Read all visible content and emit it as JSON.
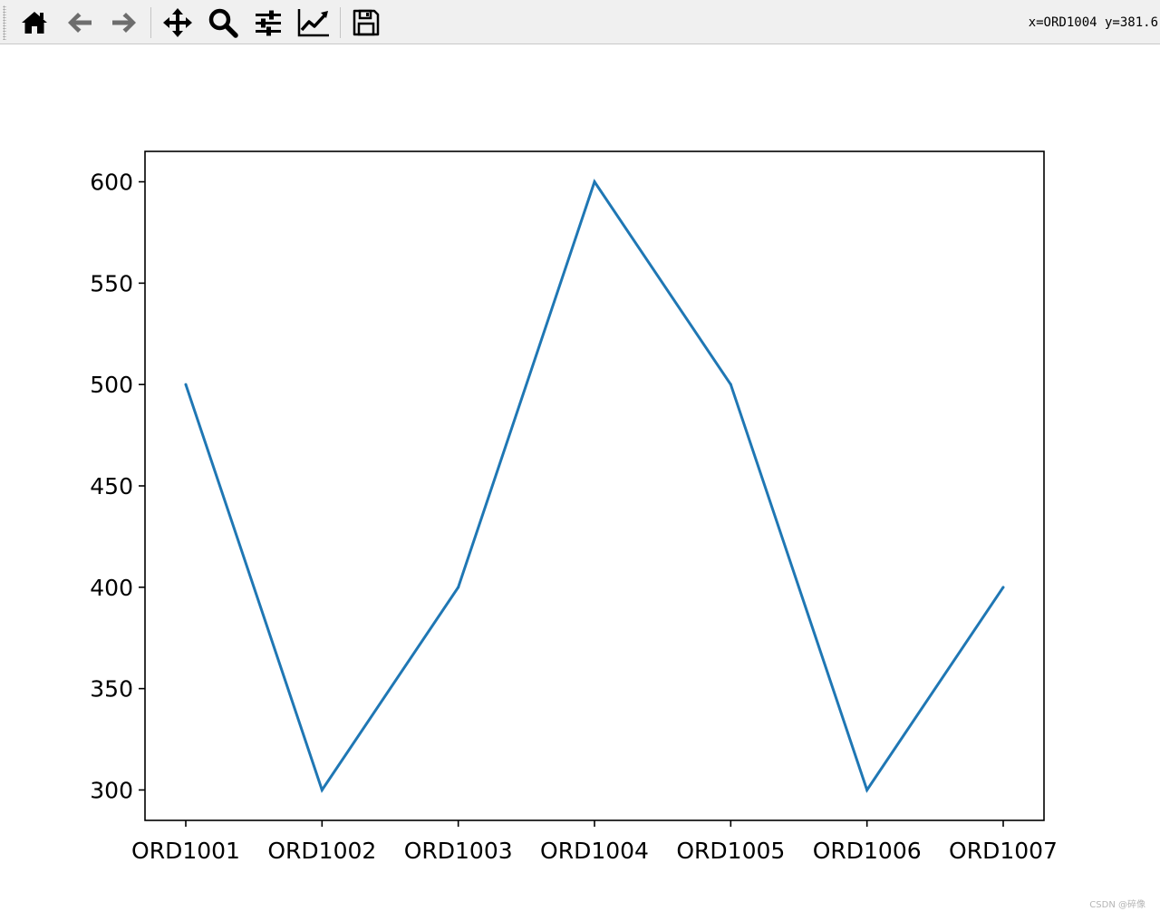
{
  "toolbar": {
    "buttons": [
      {
        "name": "home",
        "icon": "home-icon"
      },
      {
        "name": "back",
        "icon": "arrow-left-icon"
      },
      {
        "name": "forward",
        "icon": "arrow-right-icon"
      },
      {
        "name": "pan",
        "icon": "move-icon"
      },
      {
        "name": "zoom",
        "icon": "magnifier-icon"
      },
      {
        "name": "subplots",
        "icon": "sliders-icon"
      },
      {
        "name": "axes",
        "icon": "line-chart-icon"
      },
      {
        "name": "save",
        "icon": "floppy-disk-icon"
      }
    ],
    "coordinates": "x=ORD1004 y=381.6"
  },
  "watermark": "CSDN @碎像",
  "colors": {
    "line": "#1f77b4",
    "toolbar_bg": "#f0f0f0",
    "icon_dark": "#000000",
    "icon_disabled": "#7a7a7a"
  },
  "chart_data": {
    "type": "line",
    "categories": [
      "ORD1001",
      "ORD1002",
      "ORD1003",
      "ORD1004",
      "ORD1005",
      "ORD1006",
      "ORD1007"
    ],
    "values": [
      500,
      300,
      400,
      600,
      500,
      300,
      400
    ],
    "ylim": [
      285,
      615
    ],
    "yticks": [
      300,
      350,
      400,
      450,
      500,
      550,
      600
    ],
    "title": "",
    "xlabel": "",
    "ylabel": "",
    "grid": false,
    "legend": false
  }
}
